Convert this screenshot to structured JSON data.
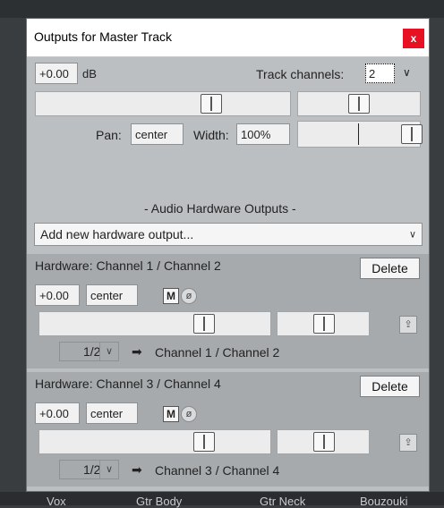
{
  "window": {
    "title": "Outputs for Master Track",
    "close_label": "x"
  },
  "master": {
    "volume": "+0.00",
    "volume_unit": "dB",
    "track_channels_label": "Track channels:",
    "track_channels_value": "2",
    "pan_label": "Pan:",
    "pan_value": "center",
    "width_label": "Width:",
    "width_value": "100%"
  },
  "section_heading": "- Audio Hardware Outputs -",
  "add_output": {
    "label": "Add new hardware output..."
  },
  "hardware_outputs": [
    {
      "title": "Hardware: Channel 1 / Channel 2",
      "delete_label": "Delete",
      "volume": "+0.00",
      "pan": "center",
      "mute_label": "M",
      "phase_label": "ø",
      "channel_select": "1/2",
      "arrow": "➡",
      "destination": "Channel 1 / Channel 2"
    },
    {
      "title": "Hardware: Channel 3 / Channel 4",
      "delete_label": "Delete",
      "volume": "+0.00",
      "pan": "center",
      "mute_label": "M",
      "phase_label": "ø",
      "channel_select": "1/2",
      "arrow": "➡",
      "destination": "Channel 3 / Channel 4"
    }
  ],
  "background_tracks": [
    "Vox",
    "Gtr Body",
    "Gtr Neck",
    "Bouzouki"
  ],
  "colors": {
    "close_button": "#e81123",
    "panel": "#bcbfc1",
    "hardware_panel": "#a7aaac"
  }
}
